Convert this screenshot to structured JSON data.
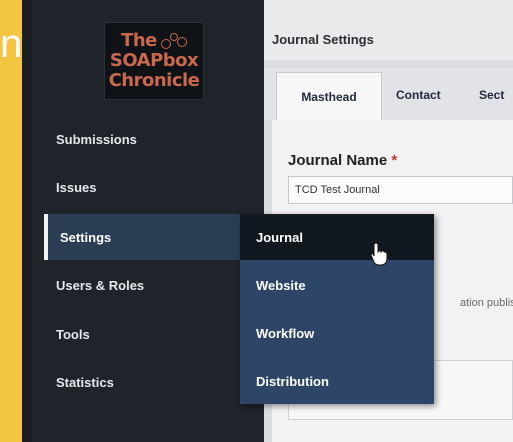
{
  "frame": {
    "edge_text": "n"
  },
  "logo": {
    "line1": "The",
    "line2": "SOAPbox",
    "line3": "Chronicle"
  },
  "sidebar": {
    "items": [
      {
        "label": "Submissions"
      },
      {
        "label": "Issues"
      },
      {
        "label": "Settings",
        "active": true
      },
      {
        "label": "Users & Roles"
      },
      {
        "label": "Tools"
      },
      {
        "label": "Statistics"
      }
    ]
  },
  "settings_menu": {
    "items": [
      {
        "label": "Journal",
        "hover": true
      },
      {
        "label": "Website"
      },
      {
        "label": "Workflow"
      },
      {
        "label": "Distribution"
      }
    ]
  },
  "content": {
    "title": "Journal Settings",
    "tabs": [
      {
        "label": "Masthead",
        "active": true
      },
      {
        "label": "Contact"
      },
      {
        "label": "Sect"
      }
    ],
    "journal_name": {
      "label": "Journal Name",
      "required_mark": "*",
      "value": "TCD Test Journal"
    },
    "description_fragment": "ation publish"
  },
  "colors": {
    "frame": "#f4c542",
    "sidebar": "#1f232a",
    "active_nav": "#2b3d55",
    "flyout": "#2d4566",
    "logo_text": "#c9684d"
  }
}
